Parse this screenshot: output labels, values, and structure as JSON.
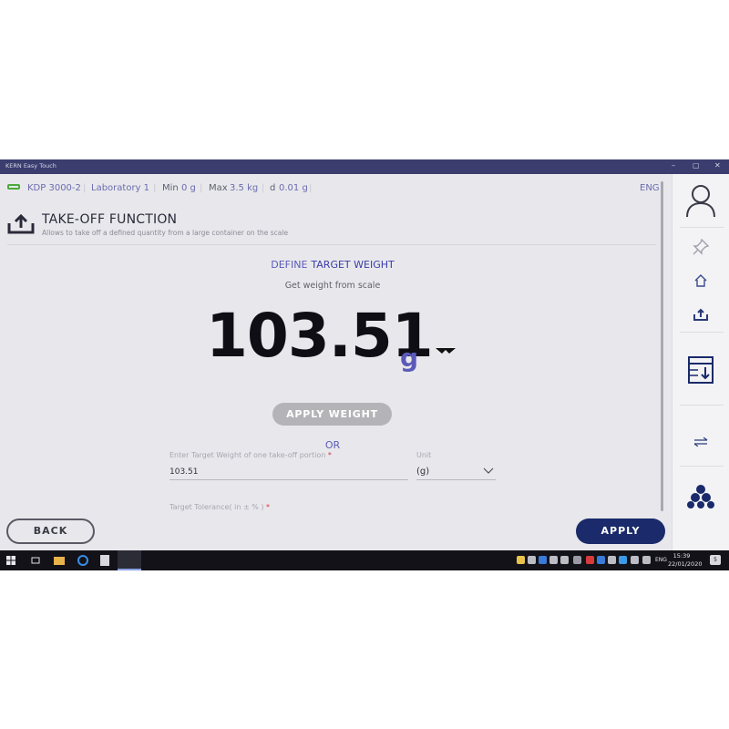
{
  "window": {
    "title": "KERN Easy Touch",
    "minimize": "–",
    "maximize": "▢",
    "close": "✕"
  },
  "infobar": {
    "device": "KDP 3000-2",
    "location": "Laboratory 1",
    "min_label": "Min",
    "min_value": "0 g",
    "max_label": "Max",
    "max_value": "3.5 kg",
    "d_label": "d",
    "d_value": "0.01 g",
    "language": "ENG"
  },
  "header": {
    "title": "TAKE-OFF FUNCTION",
    "subtitle": "Allows to take off a defined quantity from a large container on the scale"
  },
  "define": {
    "prefix": "DEFINE",
    "target": "TARGET WEIGHT"
  },
  "get_weight_text": "Get weight from scale",
  "reading": {
    "value": "103.51",
    "unit": "g"
  },
  "apply_weight_label": "APPLY WEIGHT",
  "or_label": "OR",
  "form": {
    "target_label": "Enter Target Weight of one take-off portion",
    "required_mark": "*",
    "target_value": "103.51",
    "unit_label": "Unit",
    "unit_value": "(g)",
    "tolerance_label": "Target Tolerance( in ± % )"
  },
  "buttons": {
    "back": "BACK",
    "apply": "APPLY"
  },
  "taskbar": {
    "time": "15:39",
    "date": "22/01/2020",
    "language": "ENG",
    "notifications": "5"
  },
  "colors": {
    "accent": "#5a5ab8",
    "primary": "#1a2a6a",
    "titlebar": "#3a3d6e",
    "status_ok": "#4caa3a"
  }
}
